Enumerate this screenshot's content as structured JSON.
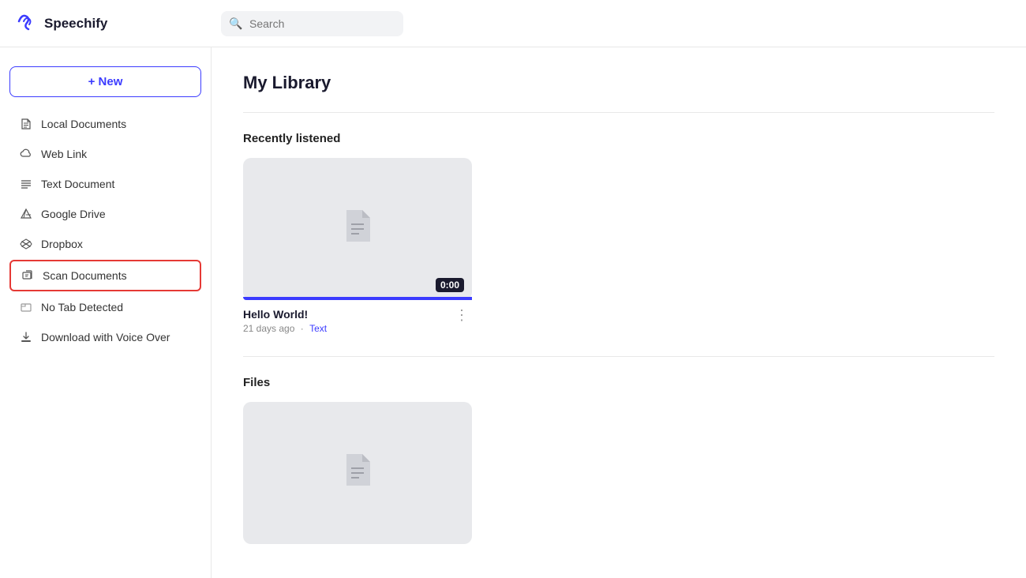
{
  "header": {
    "logo_text": "Speechify",
    "search_placeholder": "Search"
  },
  "sidebar": {
    "new_button_label": "+ New",
    "items": [
      {
        "id": "local-documents",
        "label": "Local Documents",
        "icon": "file-icon"
      },
      {
        "id": "web-link",
        "label": "Web Link",
        "icon": "cloud-icon"
      },
      {
        "id": "text-document",
        "label": "Text Document",
        "icon": "text-icon"
      },
      {
        "id": "google-drive",
        "label": "Google Drive",
        "icon": "drive-icon"
      },
      {
        "id": "dropbox",
        "label": "Dropbox",
        "icon": "dropbox-icon"
      },
      {
        "id": "scan-documents",
        "label": "Scan Documents",
        "icon": "scan-icon",
        "selected": true
      },
      {
        "id": "no-tab-detected",
        "label": "No Tab Detected",
        "icon": "tab-icon"
      },
      {
        "id": "download-voice-over",
        "label": "Download with Voice Over",
        "icon": "download-icon"
      }
    ]
  },
  "main": {
    "page_title": "My Library",
    "sections": [
      {
        "id": "recently-listened",
        "title": "Recently listened",
        "cards": [
          {
            "id": "hello-world",
            "title": "Hello World!",
            "time_badge": "0:00",
            "age": "21 days ago",
            "type": "Text",
            "progress": 100
          }
        ]
      },
      {
        "id": "files",
        "title": "Files",
        "cards": [
          {
            "id": "file-card-1",
            "title": "",
            "time_badge": "",
            "age": "",
            "type": "",
            "progress": 0
          }
        ]
      }
    ]
  }
}
